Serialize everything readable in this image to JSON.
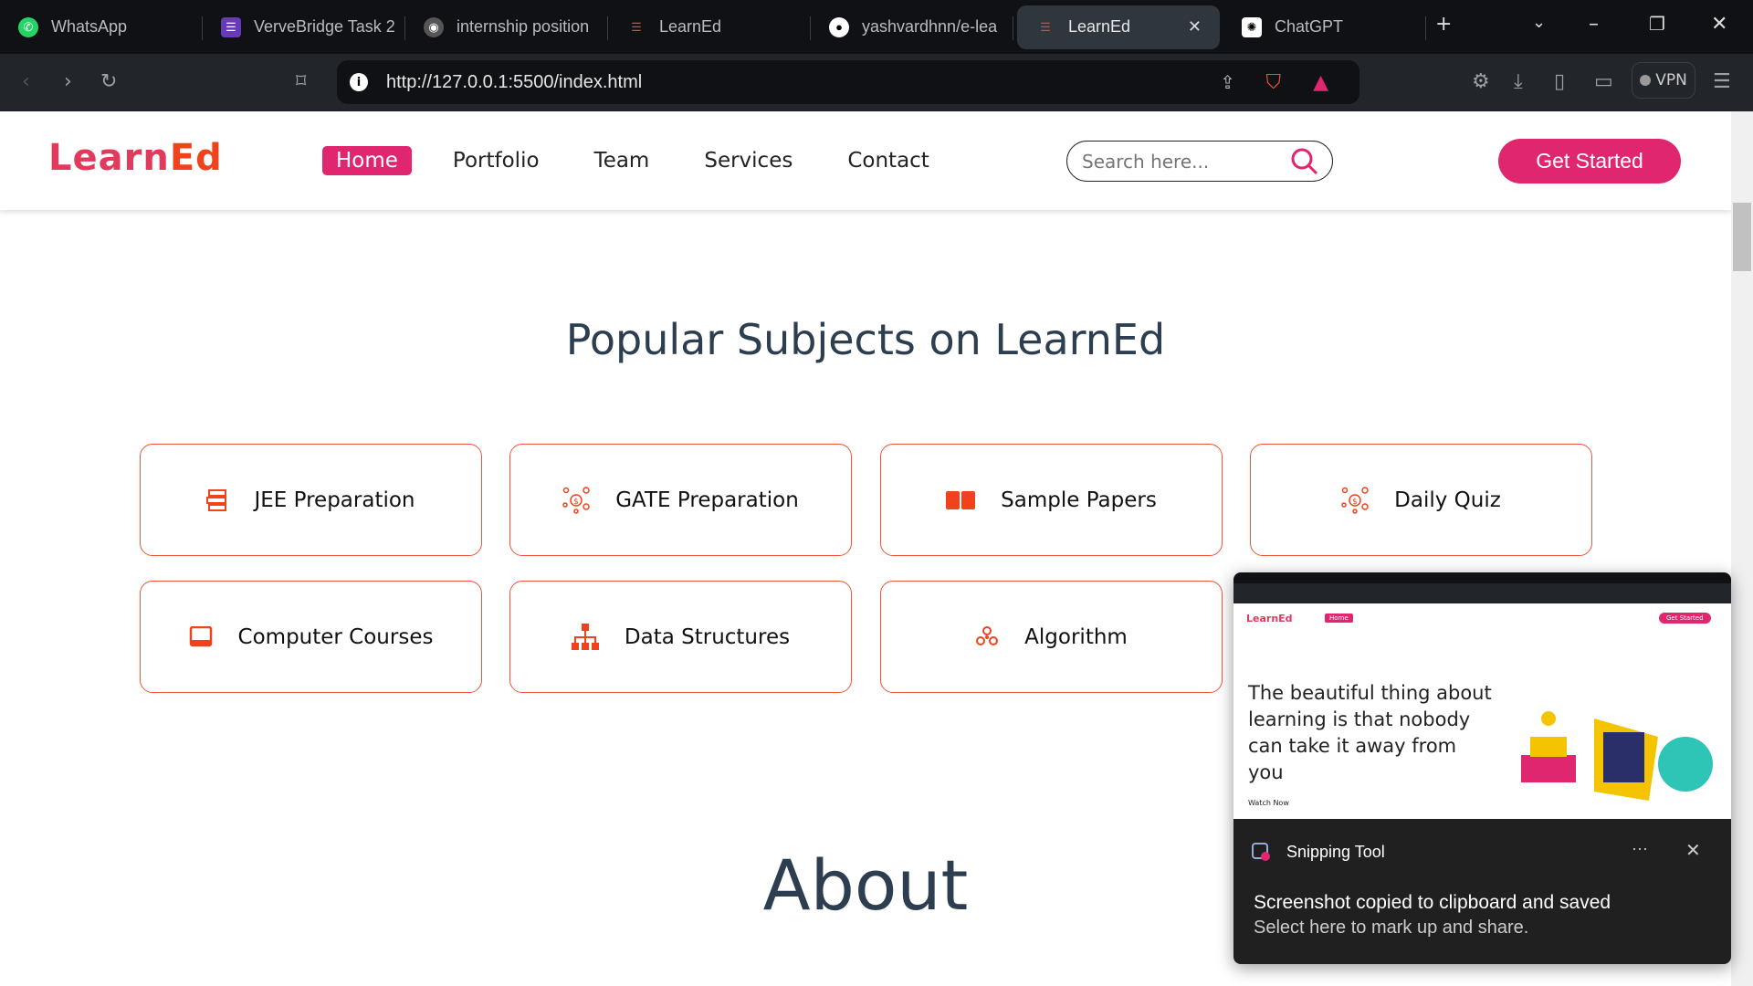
{
  "browser": {
    "tabs": [
      {
        "label": "WhatsApp",
        "icon": "whatsapp-icon",
        "color": "#25d366"
      },
      {
        "label": "VerveBridge Task 2",
        "icon": "forms-icon",
        "color": "#673ab7"
      },
      {
        "label": "internship position",
        "icon": "brave-icon",
        "color": "#444"
      },
      {
        "label": "LearnEd",
        "icon": "learned-icon",
        "color": "#f0431d"
      },
      {
        "label": "yashvardhnn/e-lea",
        "icon": "github-icon",
        "color": "#fff"
      },
      {
        "label": "LearnEd",
        "icon": "learned-icon",
        "color": "#f0431d",
        "active": true
      },
      {
        "label": "ChatGPT",
        "icon": "chatgpt-icon",
        "color": "#fff"
      }
    ],
    "url": "http://127.0.0.1:5500/index.html",
    "vpn_label": "VPN"
  },
  "site": {
    "logo": "LearnEd",
    "logo_a": "Learn",
    "logo_b": "Ed",
    "nav": [
      "Home",
      "Portfolio",
      "Team",
      "Services",
      "Contact"
    ],
    "search_placeholder": "Search here...",
    "cta": "Get Started",
    "accent": "#e0266f",
    "card_border": "#f0553a"
  },
  "subjects": {
    "title": "Popular Subjects on LearnEd",
    "items": [
      {
        "label": "JEE Preparation",
        "icon": "books-icon"
      },
      {
        "label": "GATE Preparation",
        "icon": "network-dollar-icon"
      },
      {
        "label": "Sample Papers",
        "icon": "open-book-icon"
      },
      {
        "label": "Daily Quiz",
        "icon": "network-dollar-icon"
      },
      {
        "label": "Computer Courses",
        "icon": "laptop-icon"
      },
      {
        "label": "Data Structures",
        "icon": "sitemap-icon"
      },
      {
        "label": "Algorithm",
        "icon": "molecule-icon"
      }
    ]
  },
  "about": {
    "title": "About"
  },
  "notification": {
    "app": "Snipping Tool",
    "message": "Screenshot copied to clipboard and saved",
    "sub": "Select here to mark up and share.",
    "preview": {
      "logo": "LearnEd",
      "home": "Home",
      "cta": "Get Started",
      "quote": "The beautiful thing about learning is that nobody can take it away from you",
      "watch": "Watch Now"
    }
  }
}
